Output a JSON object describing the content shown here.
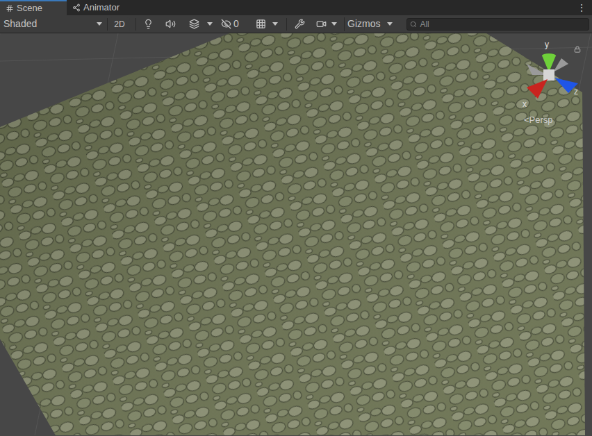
{
  "tabs": [
    {
      "label": "Scene",
      "selected": true
    },
    {
      "label": "Animator",
      "selected": false
    }
  ],
  "menu": "⋮",
  "toolbar": {
    "shading": "Shaded",
    "mode_2d": "2D",
    "mode_2d_on": false,
    "hidden_count": "0",
    "gizmos": "Gizmos",
    "search_placeholder": "All"
  },
  "gizmo": {
    "axes": [
      {
        "label": "y",
        "color": "#6fd13a"
      },
      {
        "label": "x",
        "color": "#c9241f"
      },
      {
        "label": "z",
        "color": "#1f55e6"
      }
    ],
    "projection": "<Persp"
  }
}
